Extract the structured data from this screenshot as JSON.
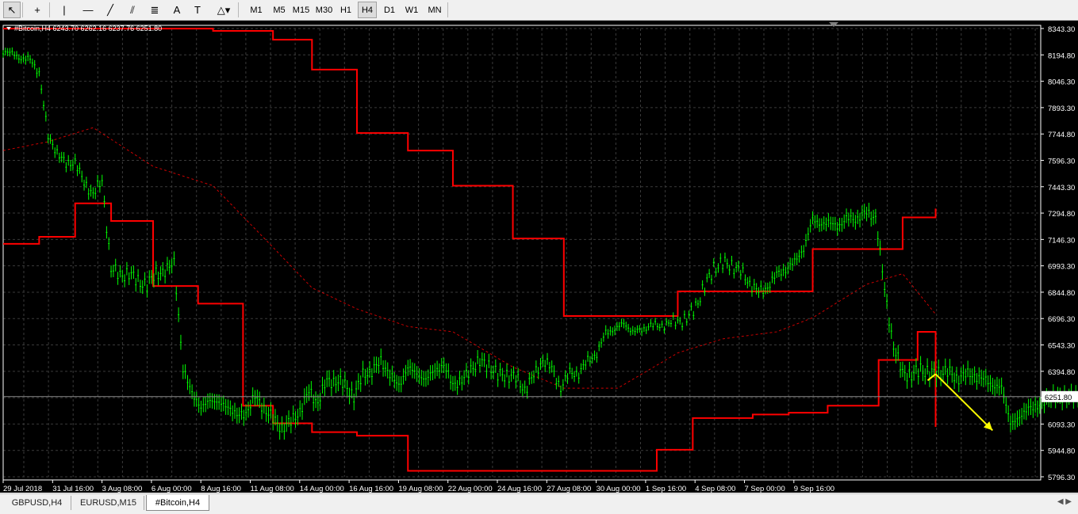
{
  "toolbar": {
    "tools": [
      {
        "name": "cursor-tool",
        "glyph": "↖"
      },
      {
        "name": "crosshair-tool",
        "glyph": "+"
      },
      {
        "name": "vertical-line-tool",
        "glyph": "|"
      },
      {
        "name": "horizontal-line-tool",
        "glyph": "—"
      },
      {
        "name": "trendline-tool",
        "glyph": "╱"
      },
      {
        "name": "channel-tool",
        "glyph": "⫽"
      },
      {
        "name": "fibonacci-tool",
        "glyph": "≣"
      },
      {
        "name": "text-tool",
        "glyph": "A"
      },
      {
        "name": "text-label-tool",
        "glyph": "T"
      },
      {
        "name": "shapes-dropdown",
        "glyph": "△▾"
      }
    ],
    "timeframes": [
      "M1",
      "M5",
      "M15",
      "M30",
      "H1",
      "H4",
      "D1",
      "W1",
      "MN"
    ],
    "active_timeframe": "H4"
  },
  "chart_header": "#Bitcoin,H4  6243.70 6262.16 6237.76 6251.80",
  "current_price_label": "6251.80",
  "tabs": [
    {
      "label": "GBPUSD,H4",
      "active": false
    },
    {
      "label": "EURUSD,M15",
      "active": false
    },
    {
      "label": "#Bitcoin,H4",
      "active": true
    }
  ],
  "colors": {
    "background": "#000000",
    "grid": "#3a3a3a",
    "candles": "#00ff00",
    "channel": "#ff0000",
    "middle": "#ff0000",
    "arrow": "#ffff00",
    "price_line": "#8a8a8a"
  },
  "chart_data": {
    "type": "line",
    "title": "#Bitcoin,H4",
    "y_ticks": [
      "8343.30",
      "8194.80",
      "8046.30",
      "7893.30",
      "7744.80",
      "7596.30",
      "7443.30",
      "7294.80",
      "7146.30",
      "6993.30",
      "6844.80",
      "6696.30",
      "6543.30",
      "6394.80",
      "6251.80",
      "6093.30",
      "5944.80",
      "5796.30"
    ],
    "ylim": [
      5796.3,
      8343.3
    ],
    "x_labels": [
      "29 Jul 2018",
      "31 Jul 16:00",
      "3 Aug 08:00",
      "6 Aug 00:00",
      "8 Aug 16:00",
      "11 Aug 08:00",
      "14 Aug 00:00",
      "16 Aug 16:00",
      "19 Aug 08:00",
      "22 Aug 00:00",
      "24 Aug 16:00",
      "27 Aug 08:00",
      "30 Aug 00:00",
      "1 Sep 16:00",
      "4 Sep 08:00",
      "7 Sep 00:00",
      "9 Sep 16:00"
    ],
    "grid": true,
    "series": [
      {
        "kind": "price",
        "x": [
          0,
          3,
          6,
          9,
          12,
          15,
          18,
          21,
          24,
          27,
          30,
          33,
          36,
          39,
          42,
          45,
          48,
          51,
          54,
          57,
          60,
          63,
          66,
          69,
          72,
          75,
          78,
          81,
          84,
          87,
          90,
          93,
          96,
          99,
          102,
          105,
          108,
          111,
          114,
          117,
          120,
          123,
          126,
          129,
          132,
          135,
          138,
          141,
          144,
          147,
          150,
          153,
          156,
          159,
          162,
          165,
          168,
          171,
          174,
          177,
          180,
          183,
          186,
          189,
          192,
          195,
          198,
          201,
          204,
          207,
          210,
          213,
          216,
          219,
          222,
          225,
          228,
          231,
          234,
          237,
          240,
          243,
          246,
          249,
          252,
          255,
          258,
          261,
          264,
          267,
          270,
          273,
          276,
          279,
          282,
          285,
          288,
          291,
          294,
          297,
          300,
          303,
          306,
          309,
          312,
          315,
          318,
          321,
          324,
          327,
          330,
          333,
          336,
          339,
          342,
          345,
          348,
          351,
          354,
          357,
          360
        ],
        "values": [
          8220,
          8195,
          8180,
          8160,
          8100,
          7720,
          7650,
          7560,
          7600,
          7450,
          7420,
          7460,
          6990,
          6930,
          6960,
          6900,
          6890,
          6950,
          6960,
          7020,
          6400,
          6280,
          6180,
          6240,
          6210,
          6200,
          6140,
          6160,
          6250,
          6190,
          6120,
          6080,
          6100,
          6180,
          6270,
          6230,
          6330,
          6350,
          6310,
          6260,
          6370,
          6400,
          6450,
          6380,
          6310,
          6420,
          6380,
          6350,
          6400,
          6430,
          6320,
          6340,
          6410,
          6450,
          6430,
          6370,
          6380,
          6350,
          6300,
          6360,
          6470,
          6400,
          6310,
          6380,
          6390,
          6450,
          6500,
          6610,
          6640,
          6660,
          6630,
          6620,
          6670,
          6640,
          6680,
          6670,
          6700,
          6760,
          6880,
          6980,
          7010,
          7000,
          6960,
          6900,
          6840,
          6880,
          6940,
          6980,
          7010,
          7100,
          7250,
          7240,
          7230,
          7230,
          7260,
          7270,
          7290,
          7280,
          6850,
          6540,
          6380,
          6380,
          6400,
          6390,
          6380,
          6400,
          6350,
          6380,
          6370,
          6350,
          6320,
          6300,
          6110,
          6120,
          6200,
          6180,
          6250,
          6240,
          6260,
          6240,
          6251.8
        ]
      },
      {
        "kind": "upper",
        "x": [
          0,
          12,
          30,
          70,
          74,
          90,
          103,
          118,
          135,
          150,
          170,
          187,
          205,
          225,
          240,
          258,
          270,
          288,
          300,
          311
        ],
        "values": [
          8343,
          8343,
          8343,
          8330,
          8330,
          8280,
          8110,
          7750,
          7650,
          7450,
          7150,
          6710,
          6710,
          6850,
          6850,
          6850,
          7090,
          7090,
          7270,
          7320
        ]
      },
      {
        "kind": "lower",
        "x": [
          0,
          12,
          24,
          36,
          50,
          65,
          80,
          90,
          103,
          118,
          135,
          150,
          165,
          175,
          190,
          205,
          218,
          230,
          250,
          262,
          275,
          292,
          305,
          311
        ],
        "values": [
          7120,
          7160,
          7350,
          7250,
          6880,
          6780,
          6200,
          6100,
          6050,
          6030,
          5830,
          5830,
          5830,
          5830,
          5830,
          5830,
          5950,
          6130,
          6150,
          6160,
          6200,
          6460,
          6620,
          6080
        ]
      },
      {
        "kind": "middle",
        "x": [
          0,
          15,
          30,
          50,
          70,
          90,
          103,
          118,
          135,
          150,
          170,
          187,
          205,
          225,
          240,
          258,
          270,
          288,
          300,
          311
        ],
        "values": [
          7650,
          7700,
          7780,
          7560,
          7450,
          7100,
          6870,
          6750,
          6650,
          6620,
          6420,
          6300,
          6300,
          6500,
          6580,
          6620,
          6700,
          6890,
          6950,
          6720
        ]
      }
    ],
    "annotation": {
      "type": "arrow",
      "from": [
        311,
        6380
      ],
      "to": [
        330,
        6060
      ],
      "color": "#ffff00"
    }
  }
}
